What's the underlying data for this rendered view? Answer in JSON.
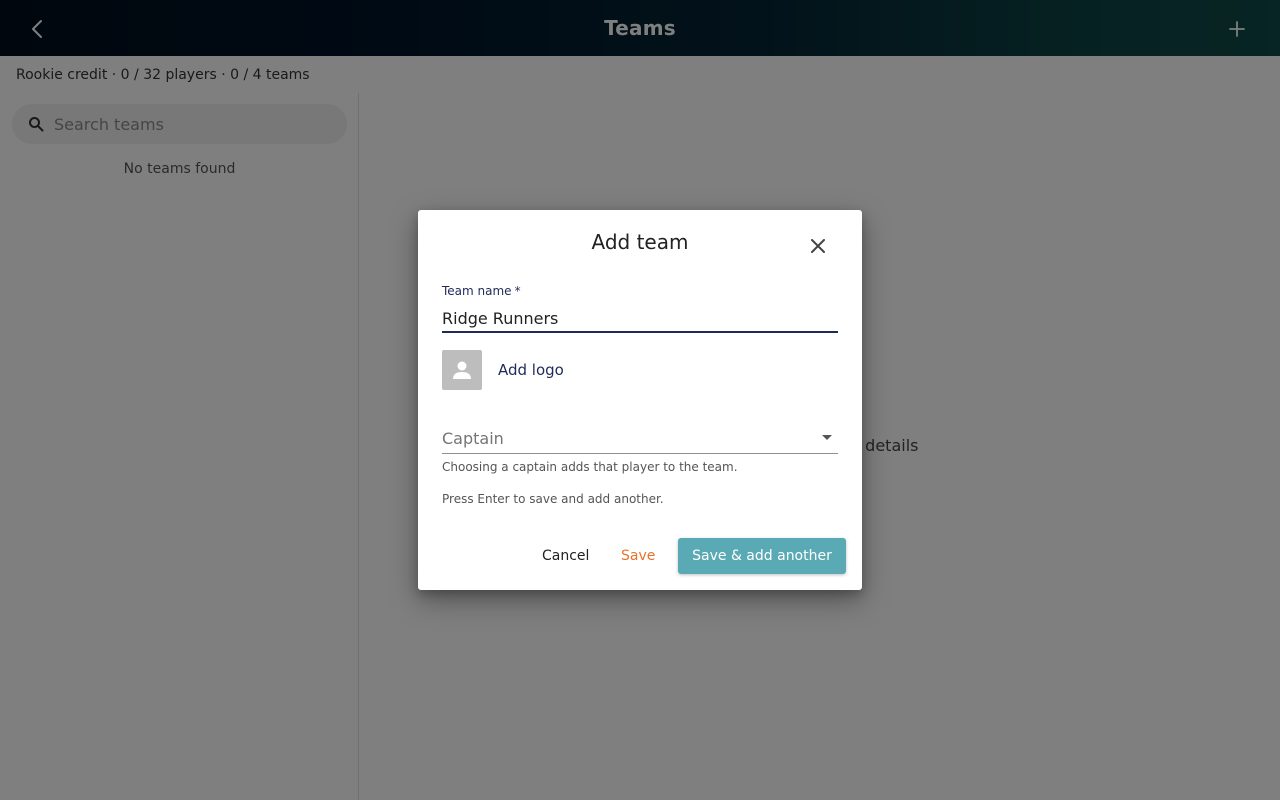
{
  "appbar": {
    "title": "Teams",
    "back_icon": "chevron-left-icon",
    "add_icon": "plus-icon"
  },
  "subheader": {
    "text": "Rookie credit · 0 / 32 players · 0 / 4 teams"
  },
  "sidebar": {
    "search_placeholder": "Search teams",
    "empty_message": "No teams found"
  },
  "main": {
    "hint_visible": "w details"
  },
  "dialog": {
    "title": "Add team",
    "team_name": {
      "label": "Team name",
      "required_marker": "*",
      "value": "Ridge Runners"
    },
    "logo": {
      "label": "Add logo"
    },
    "captain": {
      "label": "Captain",
      "helper": "Choosing a captain adds that player to the team."
    },
    "enter_hint": "Press Enter to save and add another.",
    "buttons": {
      "cancel": "Cancel",
      "save": "Save",
      "save_add_another": "Save & add another"
    }
  },
  "colors": {
    "accent_orange": "#e8732a",
    "primary_teal": "#5aaab5",
    "field_navy": "#1f2a5a"
  }
}
